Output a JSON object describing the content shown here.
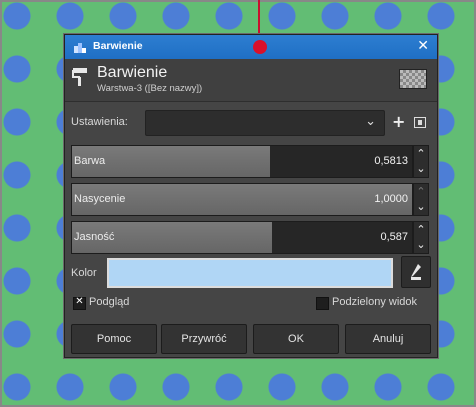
{
  "dialog": {
    "window_title": "Barwienie",
    "close_glyph": "✕",
    "header_title": "Barwienie",
    "header_subtitle": "Warstwa-3 ([Bez nazwy])"
  },
  "settings": {
    "label": "Ustawienia:",
    "value": "",
    "add_glyph": "+"
  },
  "sliders": [
    {
      "label": "Barwa",
      "value": "0,5813",
      "fraction": 0.5813
    },
    {
      "label": "Nasycenie",
      "value": "1,0000",
      "fraction": 1.0
    },
    {
      "label": "Jasność",
      "value": "0,587",
      "fraction": 0.587
    }
  ],
  "spin_glyphs": {
    "up": "⌃",
    "down": "⌄"
  },
  "color": {
    "label": "Kolor",
    "swatch": "#b0d6f5"
  },
  "options": {
    "preview_label": "Podgląd",
    "preview_checked": true,
    "preview_mark": "✕",
    "split_label": "Podzielony widok",
    "split_checked": false
  },
  "buttons": {
    "help": "Pomoc",
    "reset": "Przywróć",
    "ok": "OK",
    "cancel": "Anuluj"
  },
  "colors": {
    "canvas_green": "#62bd74",
    "dot_blue": "#4d7ed6",
    "titlebar_blue": "#2d7ed1",
    "marker_red": "#d9102a"
  }
}
